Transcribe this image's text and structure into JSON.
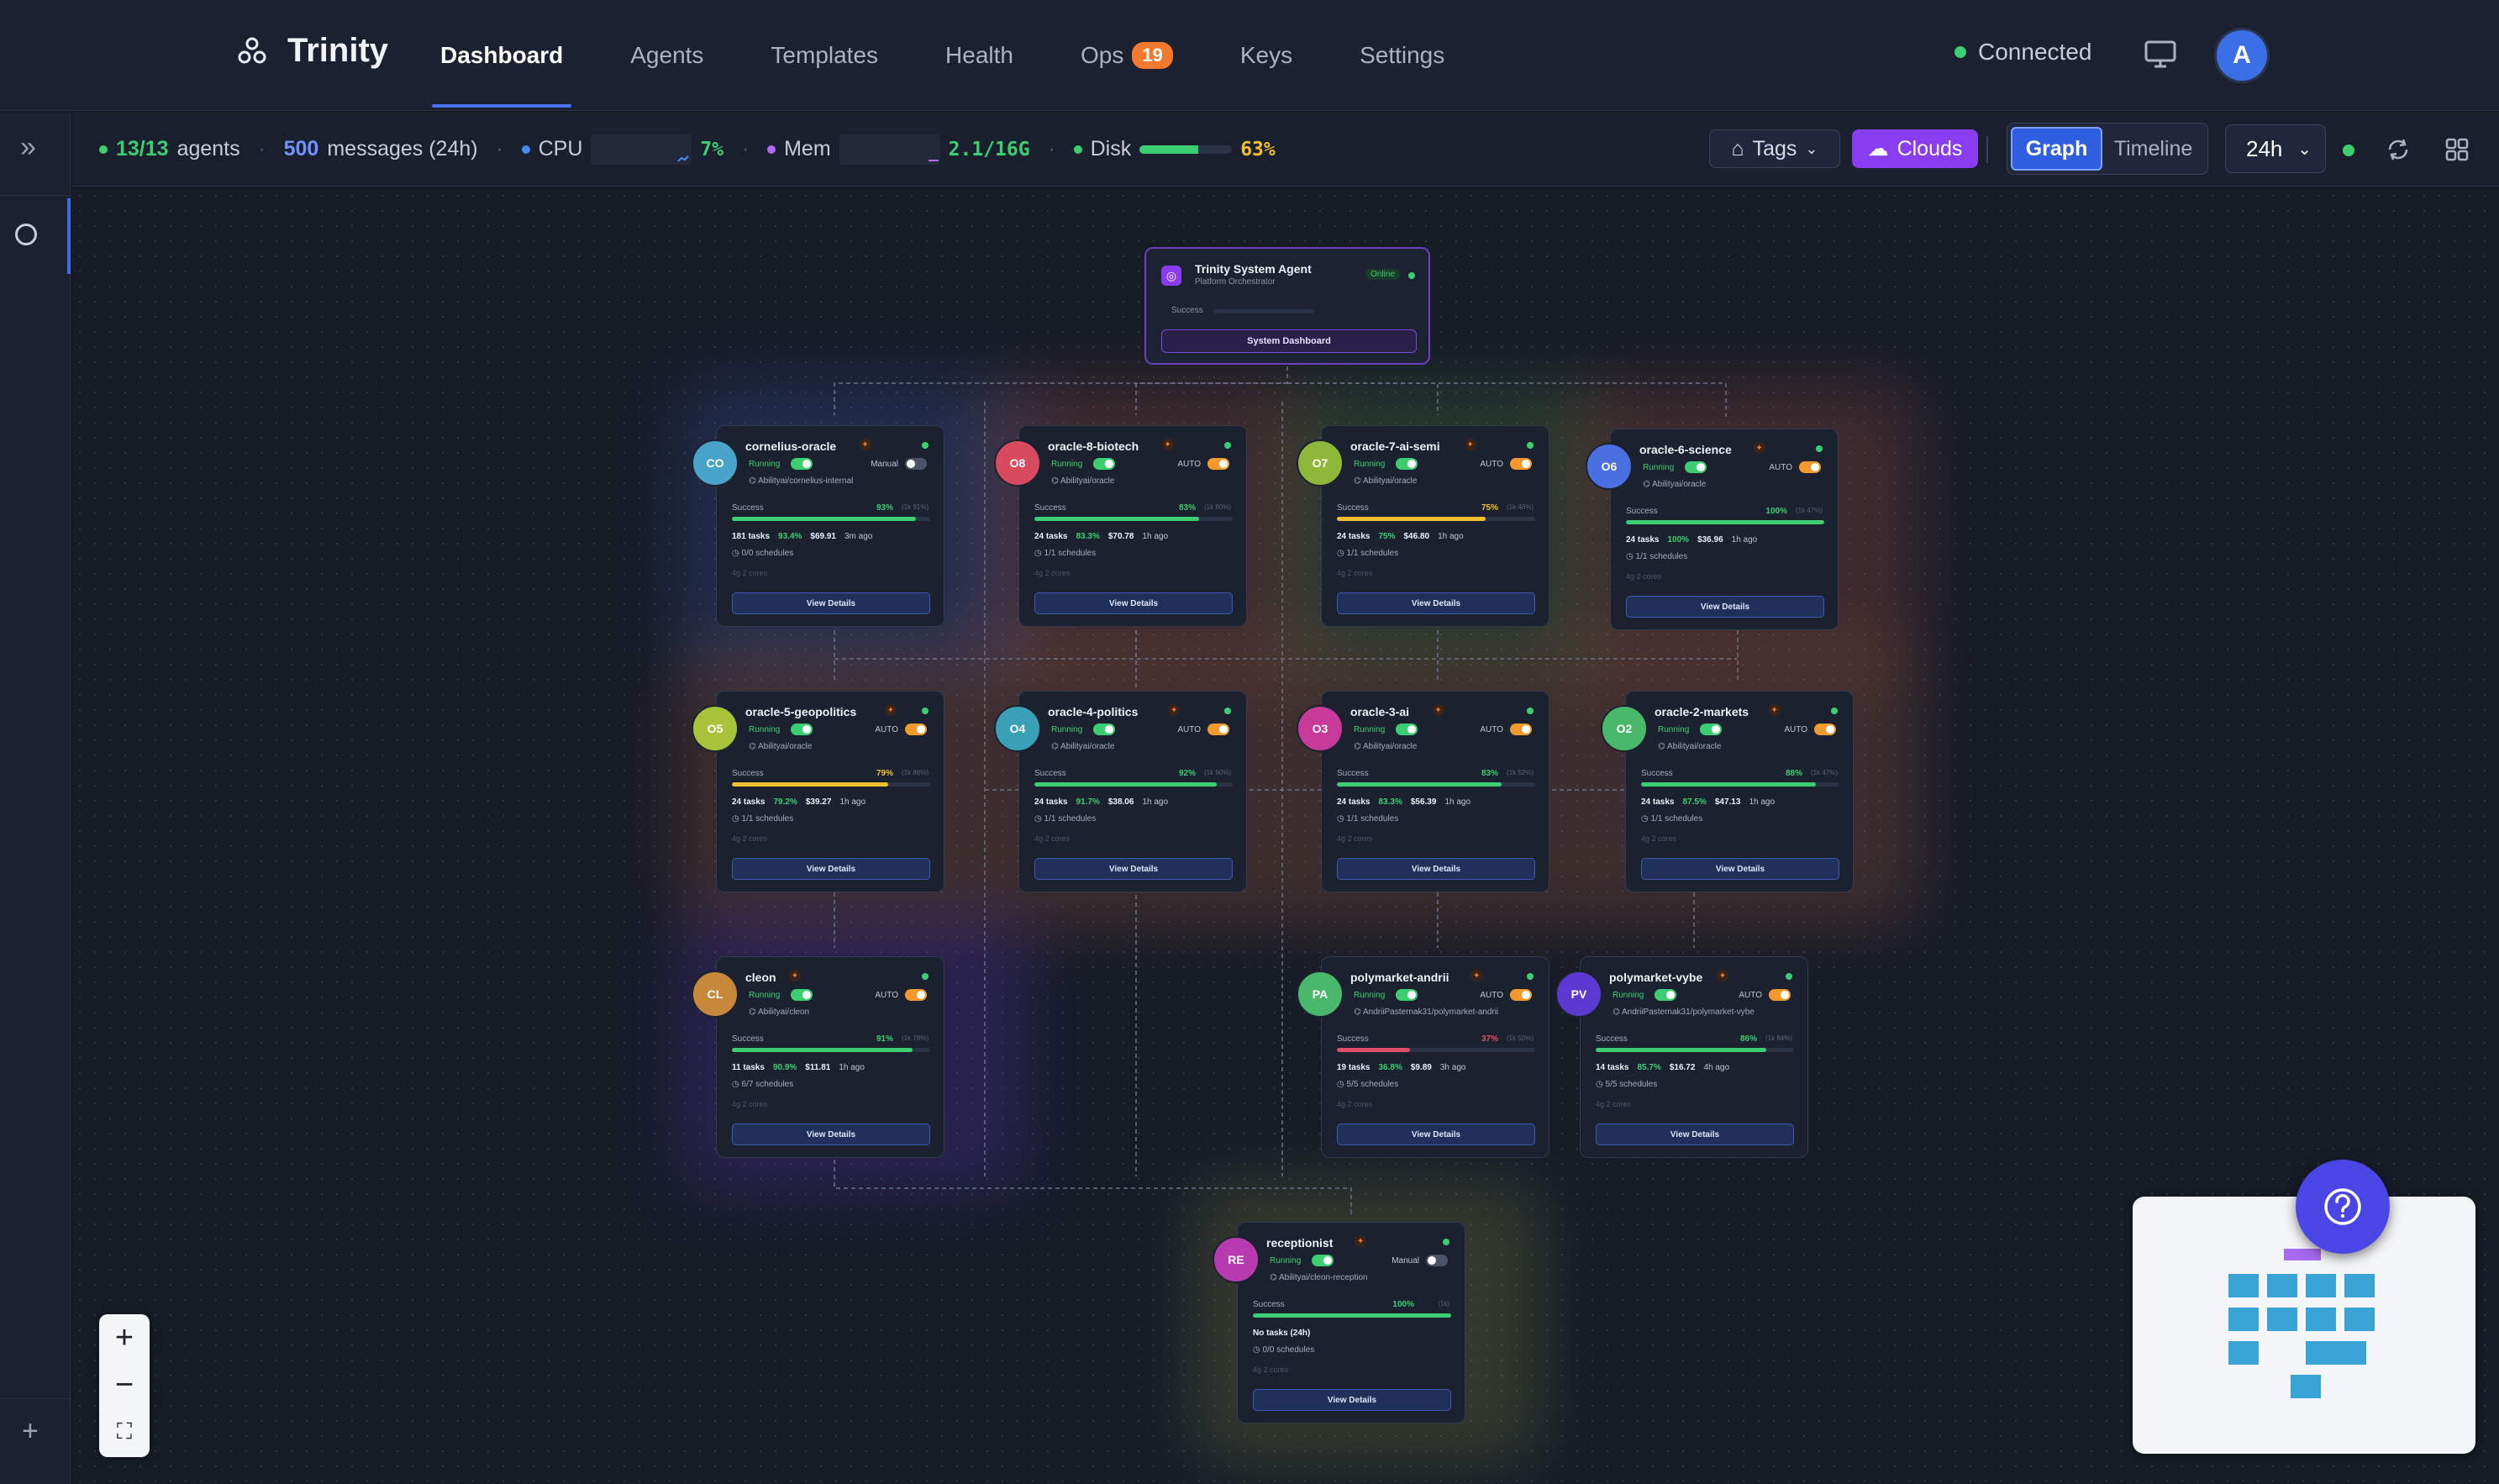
{
  "brand": "Trinity",
  "nav": [
    {
      "label": "Dashboard",
      "active": true
    },
    {
      "label": "Agents"
    },
    {
      "label": "Templates"
    },
    {
      "label": "Health"
    },
    {
      "label": "Ops",
      "badge": "19"
    },
    {
      "label": "Keys"
    },
    {
      "label": "Settings"
    }
  ],
  "connection": "Connected",
  "user_initial": "A",
  "stats": {
    "agents_value": "13/13",
    "agents_label": "agents",
    "messages_value": "500",
    "messages_label": "messages (24h)",
    "cpu_label": "CPU",
    "cpu_value": "7%",
    "mem_label": "Mem",
    "mem_value": "2.1/16G",
    "disk_label": "Disk",
    "disk_value": "63%",
    "disk_fraction": 0.63
  },
  "toolbar": {
    "tags_label": "Tags",
    "clouds_label": "Clouds",
    "graph_label": "Graph",
    "timeline_label": "Timeline",
    "range_label": "24h"
  },
  "system_agent": {
    "title": "Trinity System Agent",
    "subtitle": "Platform Orchestrator",
    "status": "Online",
    "success_label": "Success",
    "button": "System Dashboard"
  },
  "agents": [
    {
      "initials": "CO",
      "name": "cornelius-oracle",
      "status": "Running",
      "mode": "Manual",
      "auto": false,
      "repo": "Abilityai/cornelius-internal",
      "success_label": "Success",
      "pct": "93%",
      "pct_detail": "(1k 91%)",
      "success_fraction": 0.93,
      "tasks": "181 tasks",
      "rate": "93.4%",
      "cost": "$69.91",
      "ago": "3m ago",
      "schedules": "0/0 schedules",
      "caps": "4g   2 cores",
      "button": "View Details",
      "color": "#4aa3c8"
    },
    {
      "initials": "O8",
      "name": "oracle-8-biotech",
      "status": "Running",
      "mode": "AUTO",
      "auto": true,
      "repo": "Abilityai/oracle",
      "success_label": "Success",
      "pct": "83%",
      "pct_detail": "(1k 80%)",
      "success_fraction": 0.83,
      "tasks": "24 tasks",
      "rate": "83.3%",
      "cost": "$70.78",
      "ago": "1h ago",
      "schedules": "1/1 schedules",
      "caps": "4g   2 cores",
      "button": "View Details",
      "color": "#d84a5e"
    },
    {
      "initials": "O7",
      "name": "oracle-7-ai-semi",
      "status": "Running",
      "mode": "AUTO",
      "auto": true,
      "repo": "Abilityai/oracle",
      "success_label": "Success",
      "pct": "75%",
      "pct_detail": "(1k 46%)",
      "success_fraction": 0.75,
      "tasks": "24 tasks",
      "rate": "75%",
      "cost": "$46.80",
      "ago": "1h ago",
      "schedules": "1/1 schedules",
      "caps": "4g   2 cores",
      "button": "View Details",
      "color": "#8fb83a"
    },
    {
      "initials": "O6",
      "name": "oracle-6-science",
      "status": "Running",
      "mode": "AUTO",
      "auto": true,
      "repo": "Abilityai/oracle",
      "success_label": "Success",
      "pct": "100%",
      "pct_detail": "(1k 47%)",
      "success_fraction": 1.0,
      "tasks": "24 tasks",
      "rate": "100%",
      "cost": "$36.96",
      "ago": "1h ago",
      "schedules": "1/1 schedules",
      "caps": "4g   2 cores",
      "button": "View Details",
      "color": "#4a6fe0"
    },
    {
      "initials": "O5",
      "name": "oracle-5-geopolitics",
      "status": "Running",
      "mode": "AUTO",
      "auto": true,
      "repo": "Abilityai/oracle",
      "success_label": "Success",
      "pct": "79%",
      "pct_detail": "(1k 86%)",
      "success_fraction": 0.79,
      "tasks": "24 tasks",
      "rate": "79.2%",
      "cost": "$39.27",
      "ago": "1h ago",
      "schedules": "1/1 schedules",
      "caps": "4g   2 cores",
      "button": "View Details",
      "color": "#a8c23a"
    },
    {
      "initials": "O4",
      "name": "oracle-4-politics",
      "status": "Running",
      "mode": "AUTO",
      "auto": true,
      "repo": "Abilityai/oracle",
      "success_label": "Success",
      "pct": "92%",
      "pct_detail": "(1k 90%)",
      "success_fraction": 0.92,
      "tasks": "24 tasks",
      "rate": "91.7%",
      "cost": "$38.06",
      "ago": "1h ago",
      "schedules": "1/1 schedules",
      "caps": "4g   2 cores",
      "button": "View Details",
      "color": "#3aa0b8"
    },
    {
      "initials": "O3",
      "name": "oracle-3-ai",
      "status": "Running",
      "mode": "AUTO",
      "auto": true,
      "repo": "Abilityai/oracle",
      "success_label": "Success",
      "pct": "83%",
      "pct_detail": "(1k 52%)",
      "success_fraction": 0.83,
      "tasks": "24 tasks",
      "rate": "83.3%",
      "cost": "$56.39",
      "ago": "1h ago",
      "schedules": "1/1 schedules",
      "caps": "4g   2 cores",
      "button": "View Details",
      "color": "#c83a9a"
    },
    {
      "initials": "O2",
      "name": "oracle-2-markets",
      "status": "Running",
      "mode": "AUTO",
      "auto": true,
      "repo": "Abilityai/oracle",
      "success_label": "Success",
      "pct": "88%",
      "pct_detail": "(1k 47%)",
      "success_fraction": 0.88,
      "tasks": "24 tasks",
      "rate": "87.5%",
      "cost": "$47.13",
      "ago": "1h ago",
      "schedules": "1/1 schedules",
      "caps": "4g   2 cores",
      "button": "View Details",
      "color": "#4ab86a"
    },
    {
      "initials": "CL",
      "name": "cleon",
      "status": "Running",
      "mode": "AUTO",
      "auto": true,
      "repo": "Abilityai/cleon",
      "success_label": "Success",
      "pct": "91%",
      "pct_detail": "(1k 78%)",
      "success_fraction": 0.91,
      "tasks": "11 tasks",
      "rate": "90.9%",
      "cost": "$11.81",
      "ago": "1h ago",
      "schedules": "6/7 schedules",
      "caps": "4g   2 cores",
      "button": "View Details",
      "color": "#c8883a"
    },
    {
      "initials": "PA",
      "name": "polymarket-andrii",
      "status": "Running",
      "mode": "AUTO",
      "auto": true,
      "repo": "AndriiPasternak31/polymarket-andrii",
      "success_label": "Success",
      "pct": "37%",
      "pct_detail": "(1k 50%)",
      "success_fraction": 0.37,
      "tasks": "19 tasks",
      "rate": "36.8%",
      "cost": "$9.89",
      "ago": "3h ago",
      "schedules": "5/5 schedules",
      "caps": "4g   2 cores",
      "button": "View Details",
      "color": "#4ab86a"
    },
    {
      "initials": "PV",
      "name": "polymarket-vybe",
      "status": "Running",
      "mode": "AUTO",
      "auto": true,
      "repo": "AndriiPasternak31/polymarket-vybe",
      "success_label": "Success",
      "pct": "86%",
      "pct_detail": "(1k 84%)",
      "success_fraction": 0.86,
      "tasks": "14 tasks",
      "rate": "85.7%",
      "cost": "$16.72",
      "ago": "4h ago",
      "schedules": "5/5 schedules",
      "caps": "4g   2 cores",
      "button": "View Details",
      "color": "#5a3ad0"
    },
    {
      "initials": "RE",
      "name": "receptionist",
      "status": "Running",
      "mode": "Manual",
      "auto": false,
      "repo": "Abilityai/cleon-reception",
      "success_label": "Success",
      "pct": "100%",
      "pct_detail": "(1k)",
      "success_fraction": 1.0,
      "tasks": "No tasks (24h)",
      "rate": "",
      "cost": "",
      "ago": "",
      "schedules": "0/0 schedules",
      "caps": "4g   2 cores",
      "button": "View Details",
      "color": "#b83ab0"
    }
  ],
  "colors": {
    "accent": "#3b6fe8",
    "success": "#3ccf72",
    "warning": "#f29a2e",
    "clouds": "#8a3cf0"
  }
}
